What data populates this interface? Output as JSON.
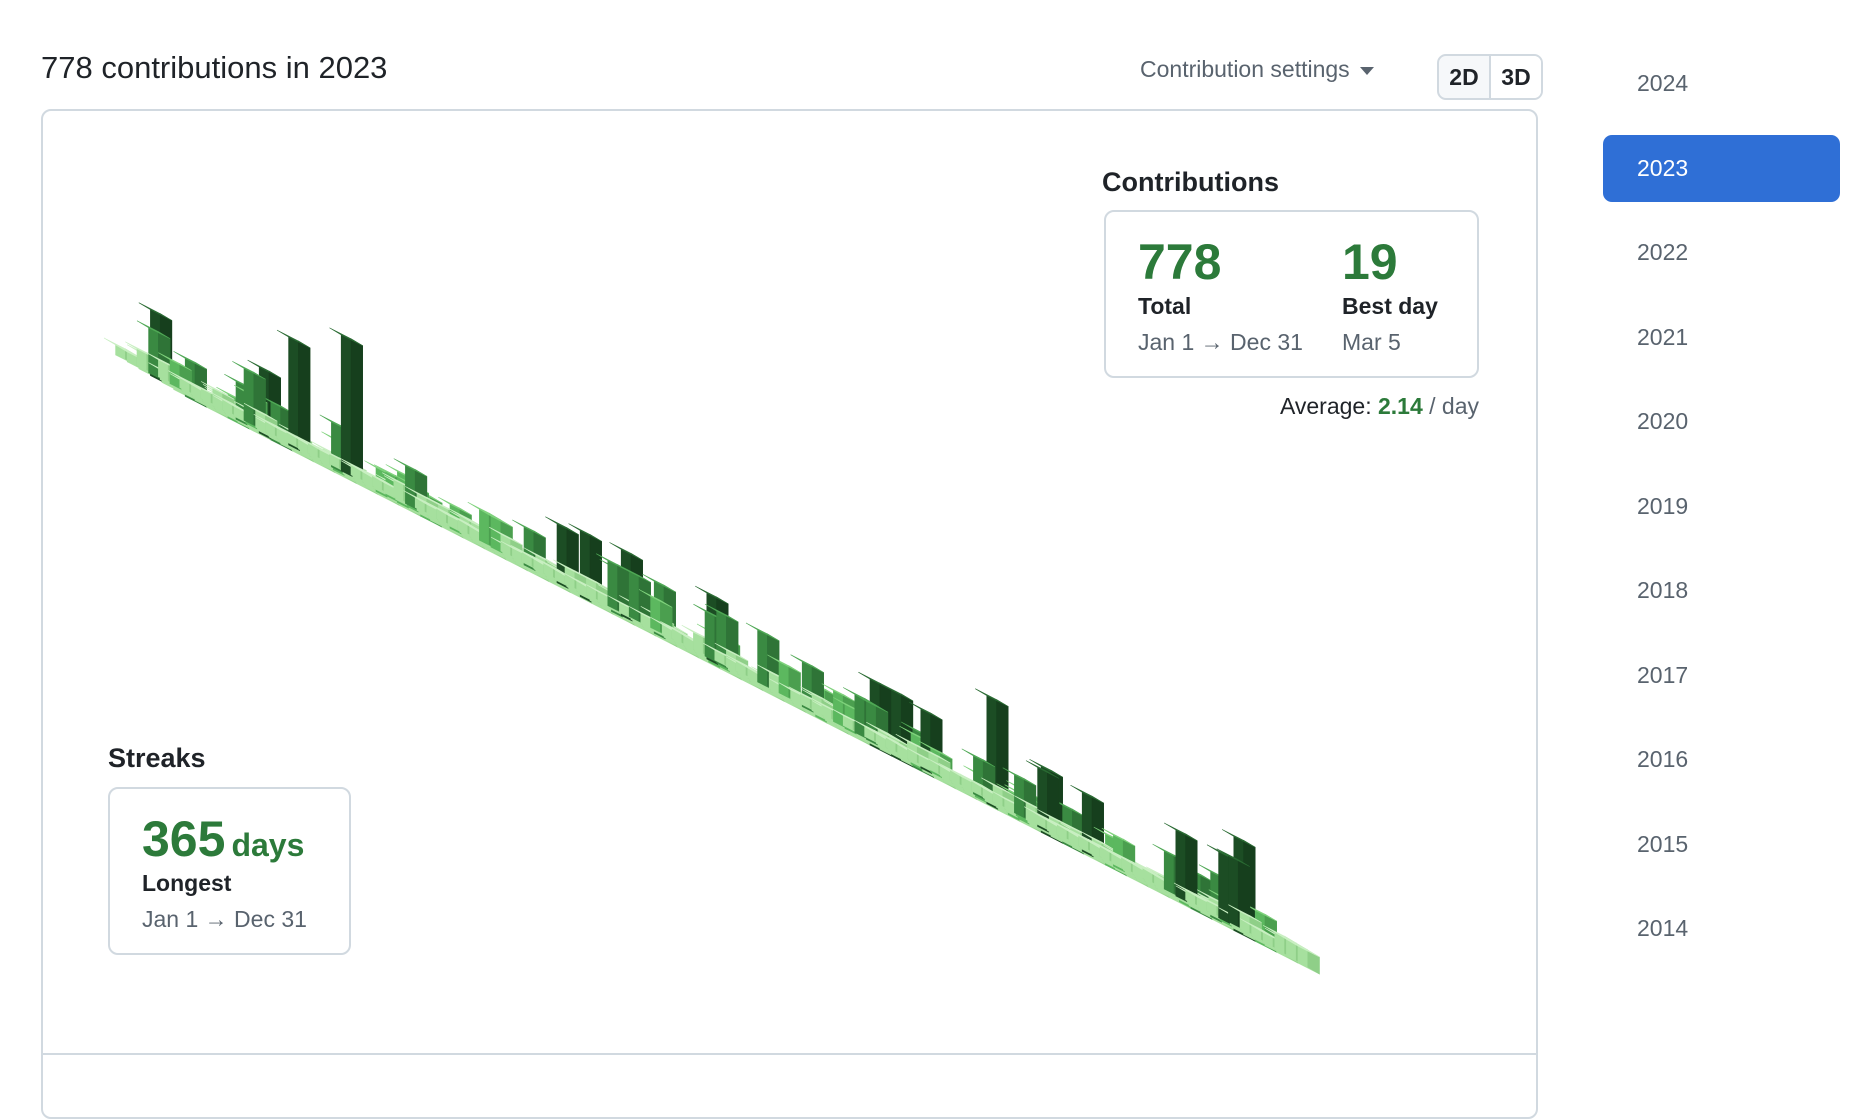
{
  "header": {
    "title": "778 contributions in 2023",
    "settings_label": "Contribution settings",
    "view_toggle": {
      "options": [
        "2D",
        "3D"
      ],
      "selected": "3D"
    }
  },
  "contributions": {
    "title": "Contributions",
    "total_value": "778",
    "total_label": "Total",
    "total_range": "Jan 1 → Dec 31",
    "best_value": "19",
    "best_label": "Best day",
    "best_date": "Mar 5",
    "average_label": "Average:",
    "average_value": "2.14",
    "average_unit": "/ day"
  },
  "streaks": {
    "title": "Streaks",
    "value": "365",
    "unit": "days",
    "label": "Longest",
    "range": "Jan 1 → Dec 31"
  },
  "years": [
    "2024",
    "2023",
    "2022",
    "2021",
    "2020",
    "2019",
    "2018",
    "2017",
    "2016",
    "2015",
    "2014"
  ],
  "selected_year": "2023",
  "colors": {
    "accent_green": "#2c7a3a",
    "selected_blue": "#2f6fd6",
    "level1": "#a8e0a0",
    "level2": "#6cc96b",
    "level3": "#3e9b46",
    "level4": "#215e2a"
  }
}
